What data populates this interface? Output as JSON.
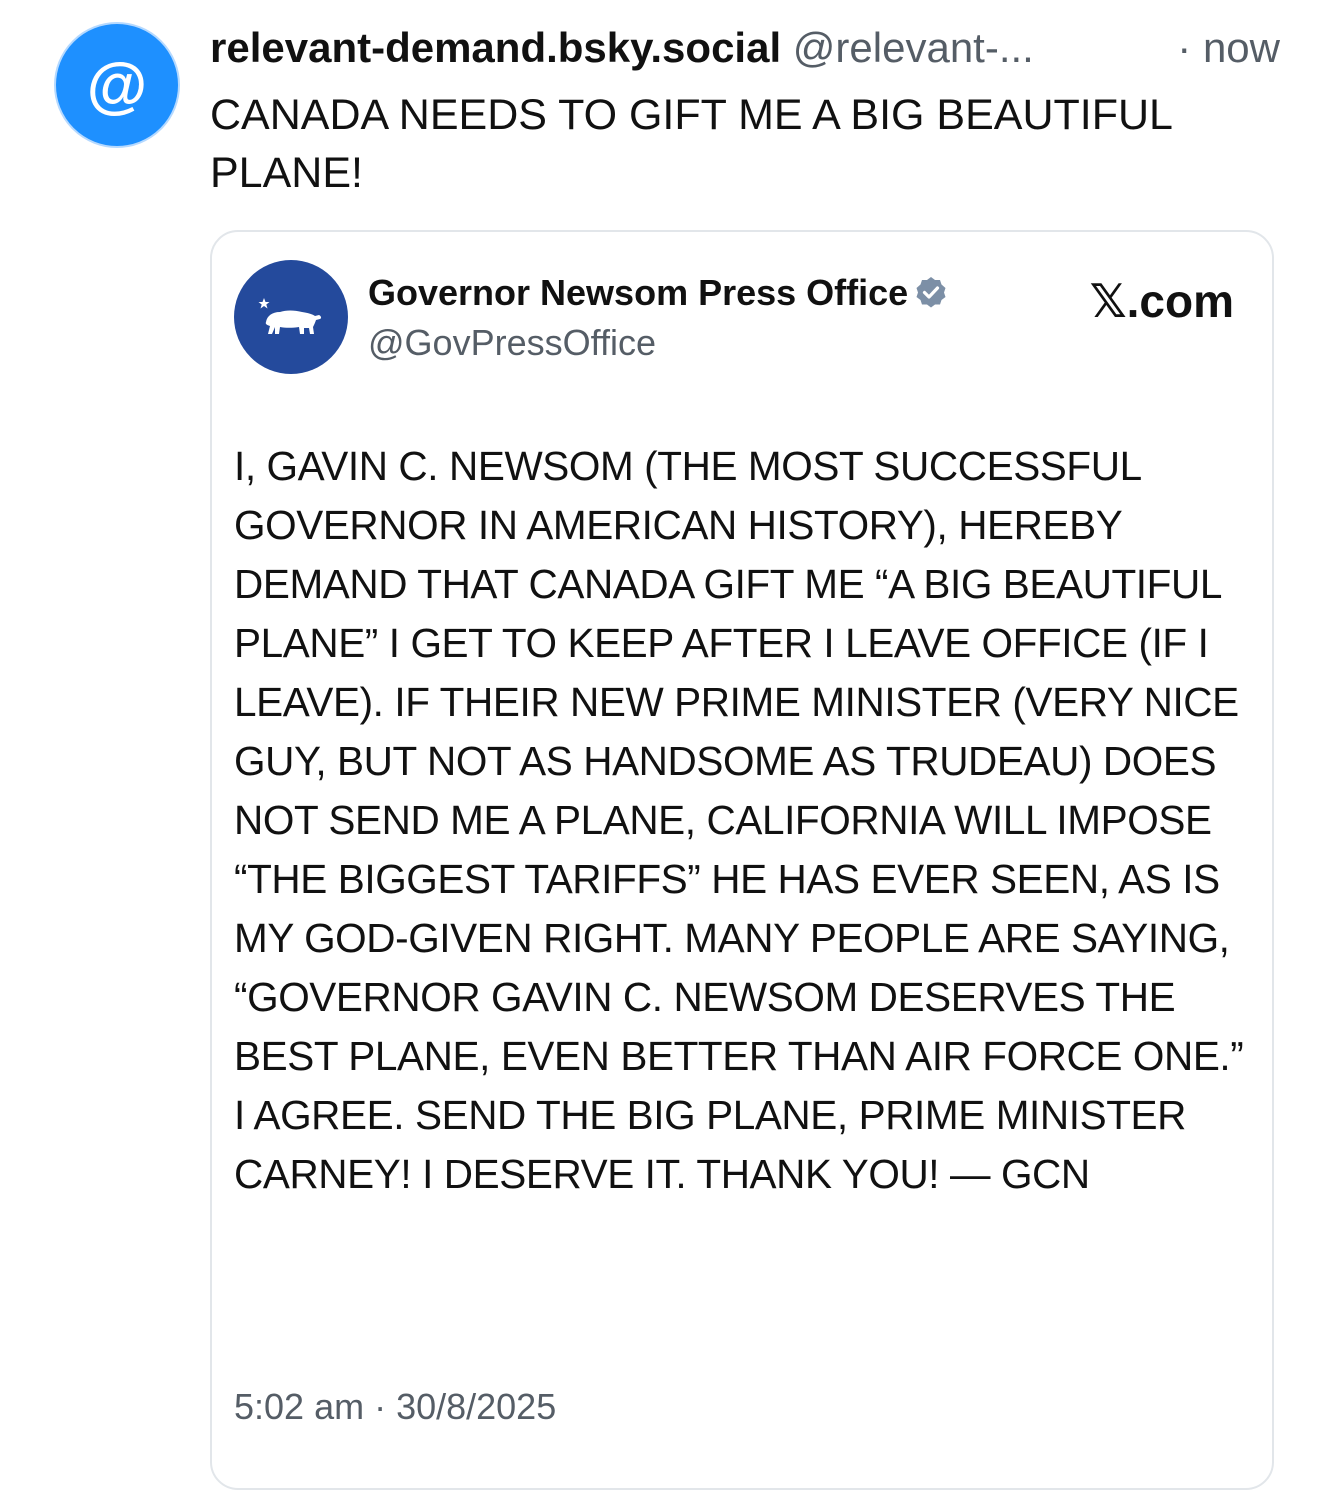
{
  "post": {
    "avatar_icon": "at-sign-icon",
    "avatar_glyph": "@",
    "display_name": "relevant-demand.bsky.social",
    "handle": "@relevant-...",
    "time": "· now",
    "text": "CANADA NEEDS TO GIFT ME A BIG BEAUTIFUL PLANE!"
  },
  "embed": {
    "avatar_icon": "california-bear-icon",
    "author_name": "Governor Newsom Press Office",
    "verified_icon": "verified-badge-icon",
    "author_handle": "@GovPressOffice",
    "source": "𝕏.com",
    "text": "I, GAVIN C. NEWSOM (THE MOST SUCCESSFUL GOVERNOR IN AMERICAN HISTORY), HEREBY DEMAND THAT CANADA GIFT ME “A BIG BEAUTIFUL PLANE” I GET TO KEEP AFTER I LEAVE OFFICE (IF I LEAVE). IF THEIR NEW PRIME MINISTER (VERY NICE GUY, BUT NOT AS HANDSOME AS TRUDEAU) DOES NOT SEND ME A PLANE, CALIFORNIA WILL IMPOSE “THE BIGGEST TARIFFS” HE HAS EVER SEEN, AS IS MY GOD-GIVEN RIGHT. MANY PEOPLE ARE SAYING, “GOVERNOR GAVIN C. NEWSOM DESERVES THE BEST PLANE, EVEN BETTER THAN AIR FORCE ONE.” I AGREE. SEND THE BIG PLANE, PRIME MINISTER CARNEY! I DESERVE IT. THANK YOU! — GCN",
    "timestamp": "5:02 am · 30/8/2025"
  },
  "colors": {
    "avatar_blue": "#1e90ff",
    "embed_avatar_blue": "#244a9c",
    "muted_text": "#555d66",
    "verified_badge": "#7c8fa6",
    "border": "#e2e6ea"
  }
}
